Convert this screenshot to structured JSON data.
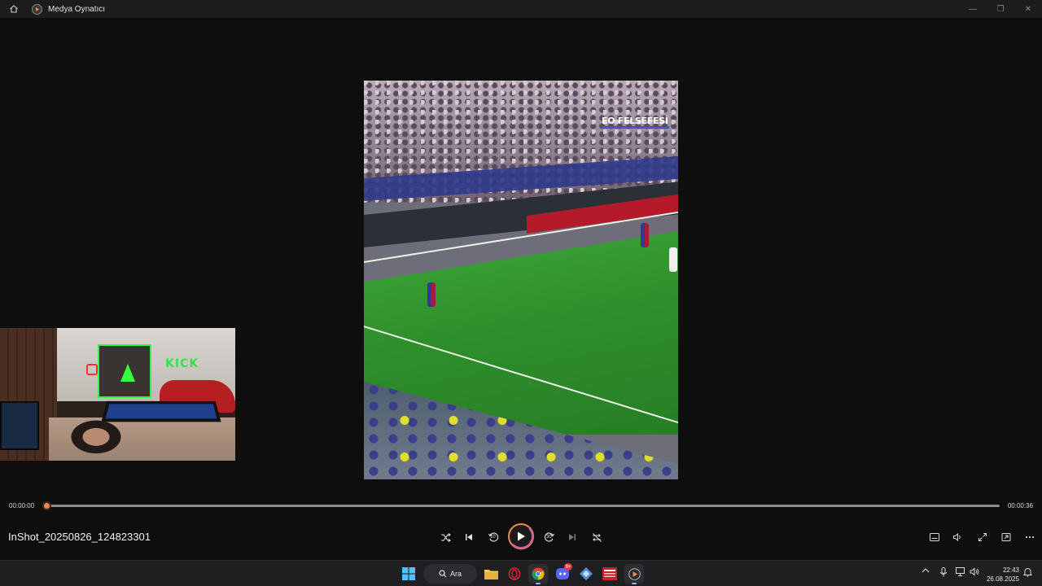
{
  "titlebar": {
    "title": "Medya Oynatıcı",
    "home_icon": "home-icon",
    "app_icon": "media-player-icon",
    "minimize": "—",
    "restore": "❐",
    "close": "✕"
  },
  "video": {
    "watermark": "EO FELSEFESİ"
  },
  "webcam": {
    "sign_text": "KICK"
  },
  "seek": {
    "current_time": "00:00:00",
    "duration": "00:00:36",
    "progress": 0.0
  },
  "player": {
    "filename": "InShot_20250826_124823301",
    "skip_back_label": "10",
    "skip_forward_label": "30",
    "accent_color": "#f08a4b"
  },
  "taskbar": {
    "search_label": "Ara",
    "clock_time": "22:43",
    "clock_date": "26.08.2025",
    "discord_badge": "9+"
  }
}
